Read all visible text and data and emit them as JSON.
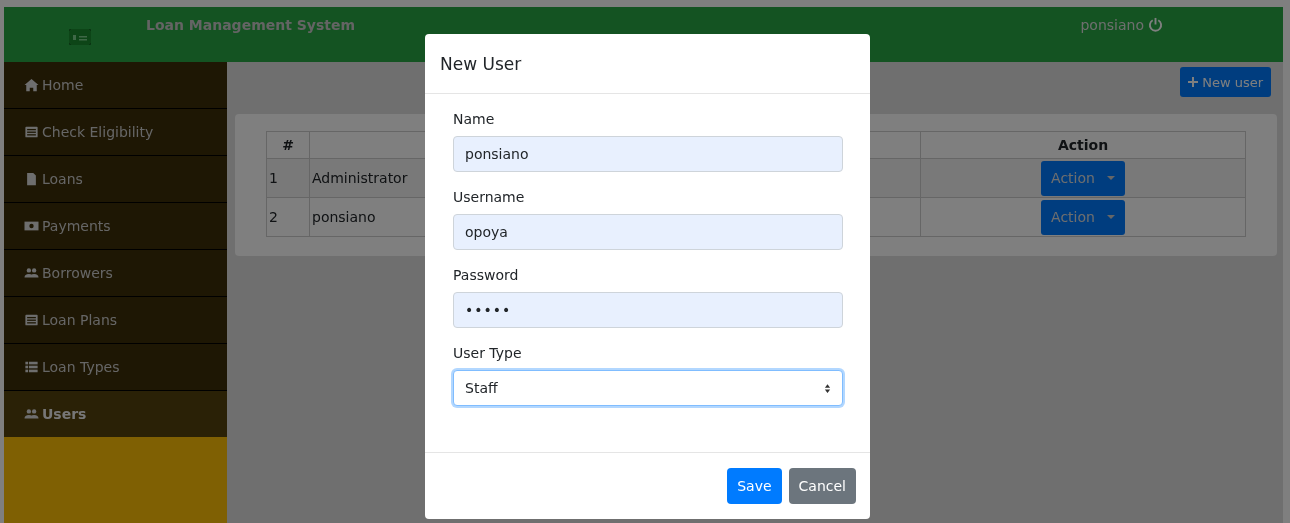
{
  "navbar": {
    "title": "Loan Management System",
    "user": "ponsiano"
  },
  "sidebar": {
    "items": [
      {
        "label": "Home",
        "kind": "home",
        "selected": false
      },
      {
        "label": "Check Eligibility",
        "kind": "list",
        "selected": false
      },
      {
        "label": "Loans",
        "kind": "file",
        "selected": false
      },
      {
        "label": "Payments",
        "kind": "money",
        "selected": false
      },
      {
        "label": "Borrowers",
        "kind": "users",
        "selected": false
      },
      {
        "label": "Loan Plans",
        "kind": "list",
        "selected": false
      },
      {
        "label": "Loan Types",
        "kind": "bullets",
        "selected": false
      },
      {
        "label": "Users",
        "kind": "users",
        "selected": true
      }
    ]
  },
  "new_user_button": "New user",
  "table": {
    "columns": [
      "#",
      "Action"
    ],
    "rows": [
      {
        "number": "1",
        "name": "Administrator",
        "action": "Action"
      },
      {
        "number": "2",
        "name": "ponsiano",
        "action": "Action"
      }
    ]
  },
  "modal": {
    "title": "New User",
    "fields": [
      {
        "label": "Name",
        "kind": "text",
        "value": "ponsiano"
      },
      {
        "label": "Username",
        "kind": "text",
        "value": "opoya"
      },
      {
        "label": "Password",
        "kind": "password",
        "value": "•••••"
      },
      {
        "label": "User Type",
        "kind": "select",
        "value": "Staff"
      }
    ],
    "buttons": [
      {
        "label": "Save",
        "kind": "primary"
      },
      {
        "label": "Cancel",
        "kind": "secondary"
      }
    ]
  }
}
